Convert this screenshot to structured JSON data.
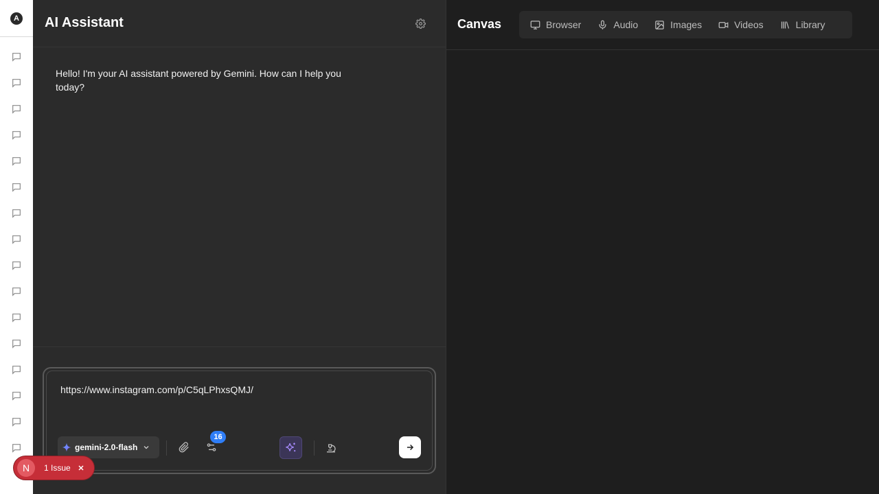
{
  "rail": {
    "logo_letter": "A",
    "items": [
      {
        "icon": "chat-bubble-icon"
      },
      {
        "icon": "chat-bubble-icon"
      },
      {
        "icon": "chat-bubble-icon"
      },
      {
        "icon": "chat-bubble-icon"
      },
      {
        "icon": "chat-bubble-icon"
      },
      {
        "icon": "chat-bubble-icon"
      },
      {
        "icon": "chat-bubble-icon"
      },
      {
        "icon": "chat-bubble-icon"
      },
      {
        "icon": "chat-bubble-icon"
      },
      {
        "icon": "chat-bubble-icon"
      },
      {
        "icon": "chat-bubble-icon"
      },
      {
        "icon": "chat-bubble-icon"
      },
      {
        "icon": "chat-bubble-icon"
      },
      {
        "icon": "chat-bubble-icon"
      },
      {
        "icon": "chat-bubble-icon"
      },
      {
        "icon": "chat-bubble-icon"
      }
    ]
  },
  "chat": {
    "title": "AI Assistant",
    "messages": [
      {
        "role": "assistant",
        "text": "Hello! I'm your AI assistant powered by Gemini. How can I help you today?"
      }
    ],
    "composer": {
      "value": "https://www.instagram.com/p/C5qLPhxsQMJ/",
      "model": "gemini-2.0-flash",
      "tools_badge": "16"
    }
  },
  "canvas": {
    "title": "Canvas",
    "tabs": [
      {
        "label": "Browser",
        "icon": "monitor-icon"
      },
      {
        "label": "Audio",
        "icon": "microphone-icon"
      },
      {
        "label": "Images",
        "icon": "image-icon"
      },
      {
        "label": "Videos",
        "icon": "video-icon"
      },
      {
        "label": "Library",
        "icon": "library-icon"
      }
    ]
  },
  "issue_toast": {
    "letter": "N",
    "label": "1 Issue"
  },
  "colors": {
    "accent_badge": "#2f7ef7",
    "issue_red": "#c62e38",
    "magic_purple": "#3b3557"
  }
}
